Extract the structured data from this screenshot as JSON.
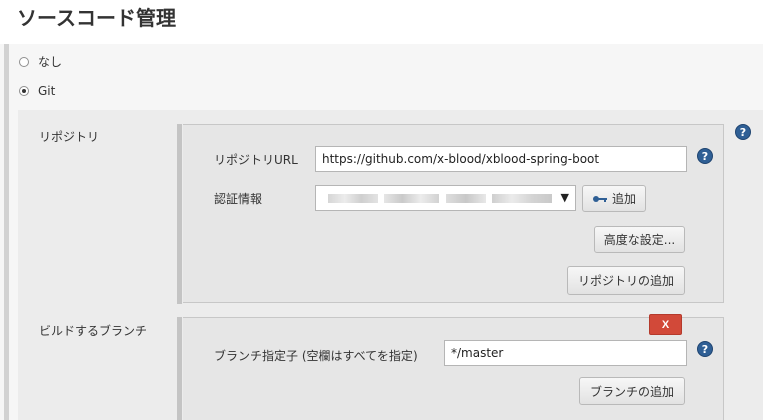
{
  "section": {
    "title": "ソースコード管理"
  },
  "scm": {
    "options": [
      {
        "label": "なし",
        "selected": false
      },
      {
        "label": "Git",
        "selected": true
      }
    ]
  },
  "repositories": {
    "label": "リポジトリ",
    "url_label": "リポジトリURL",
    "url_value": "https://github.com/x-blood/xblood-spring-boot",
    "credentials_label": "認証情報",
    "add_credential_label": "追加",
    "advanced_label": "高度な設定...",
    "add_repository_label": "リポジトリの追加"
  },
  "branches": {
    "label": "ビルドするブランチ",
    "delete_label": "X",
    "specifier_label": "ブランチ指定子 (空欄はすべてを指定)",
    "specifier_value": "*/master",
    "add_branch_label": "ブランチの追加"
  },
  "help": {
    "glyph": "?"
  },
  "icons": {
    "select_arrow": "▼",
    "help": "help-icon",
    "key": "key-icon"
  },
  "colors": {
    "delete": "#d24939",
    "help": "#2f5f95"
  }
}
